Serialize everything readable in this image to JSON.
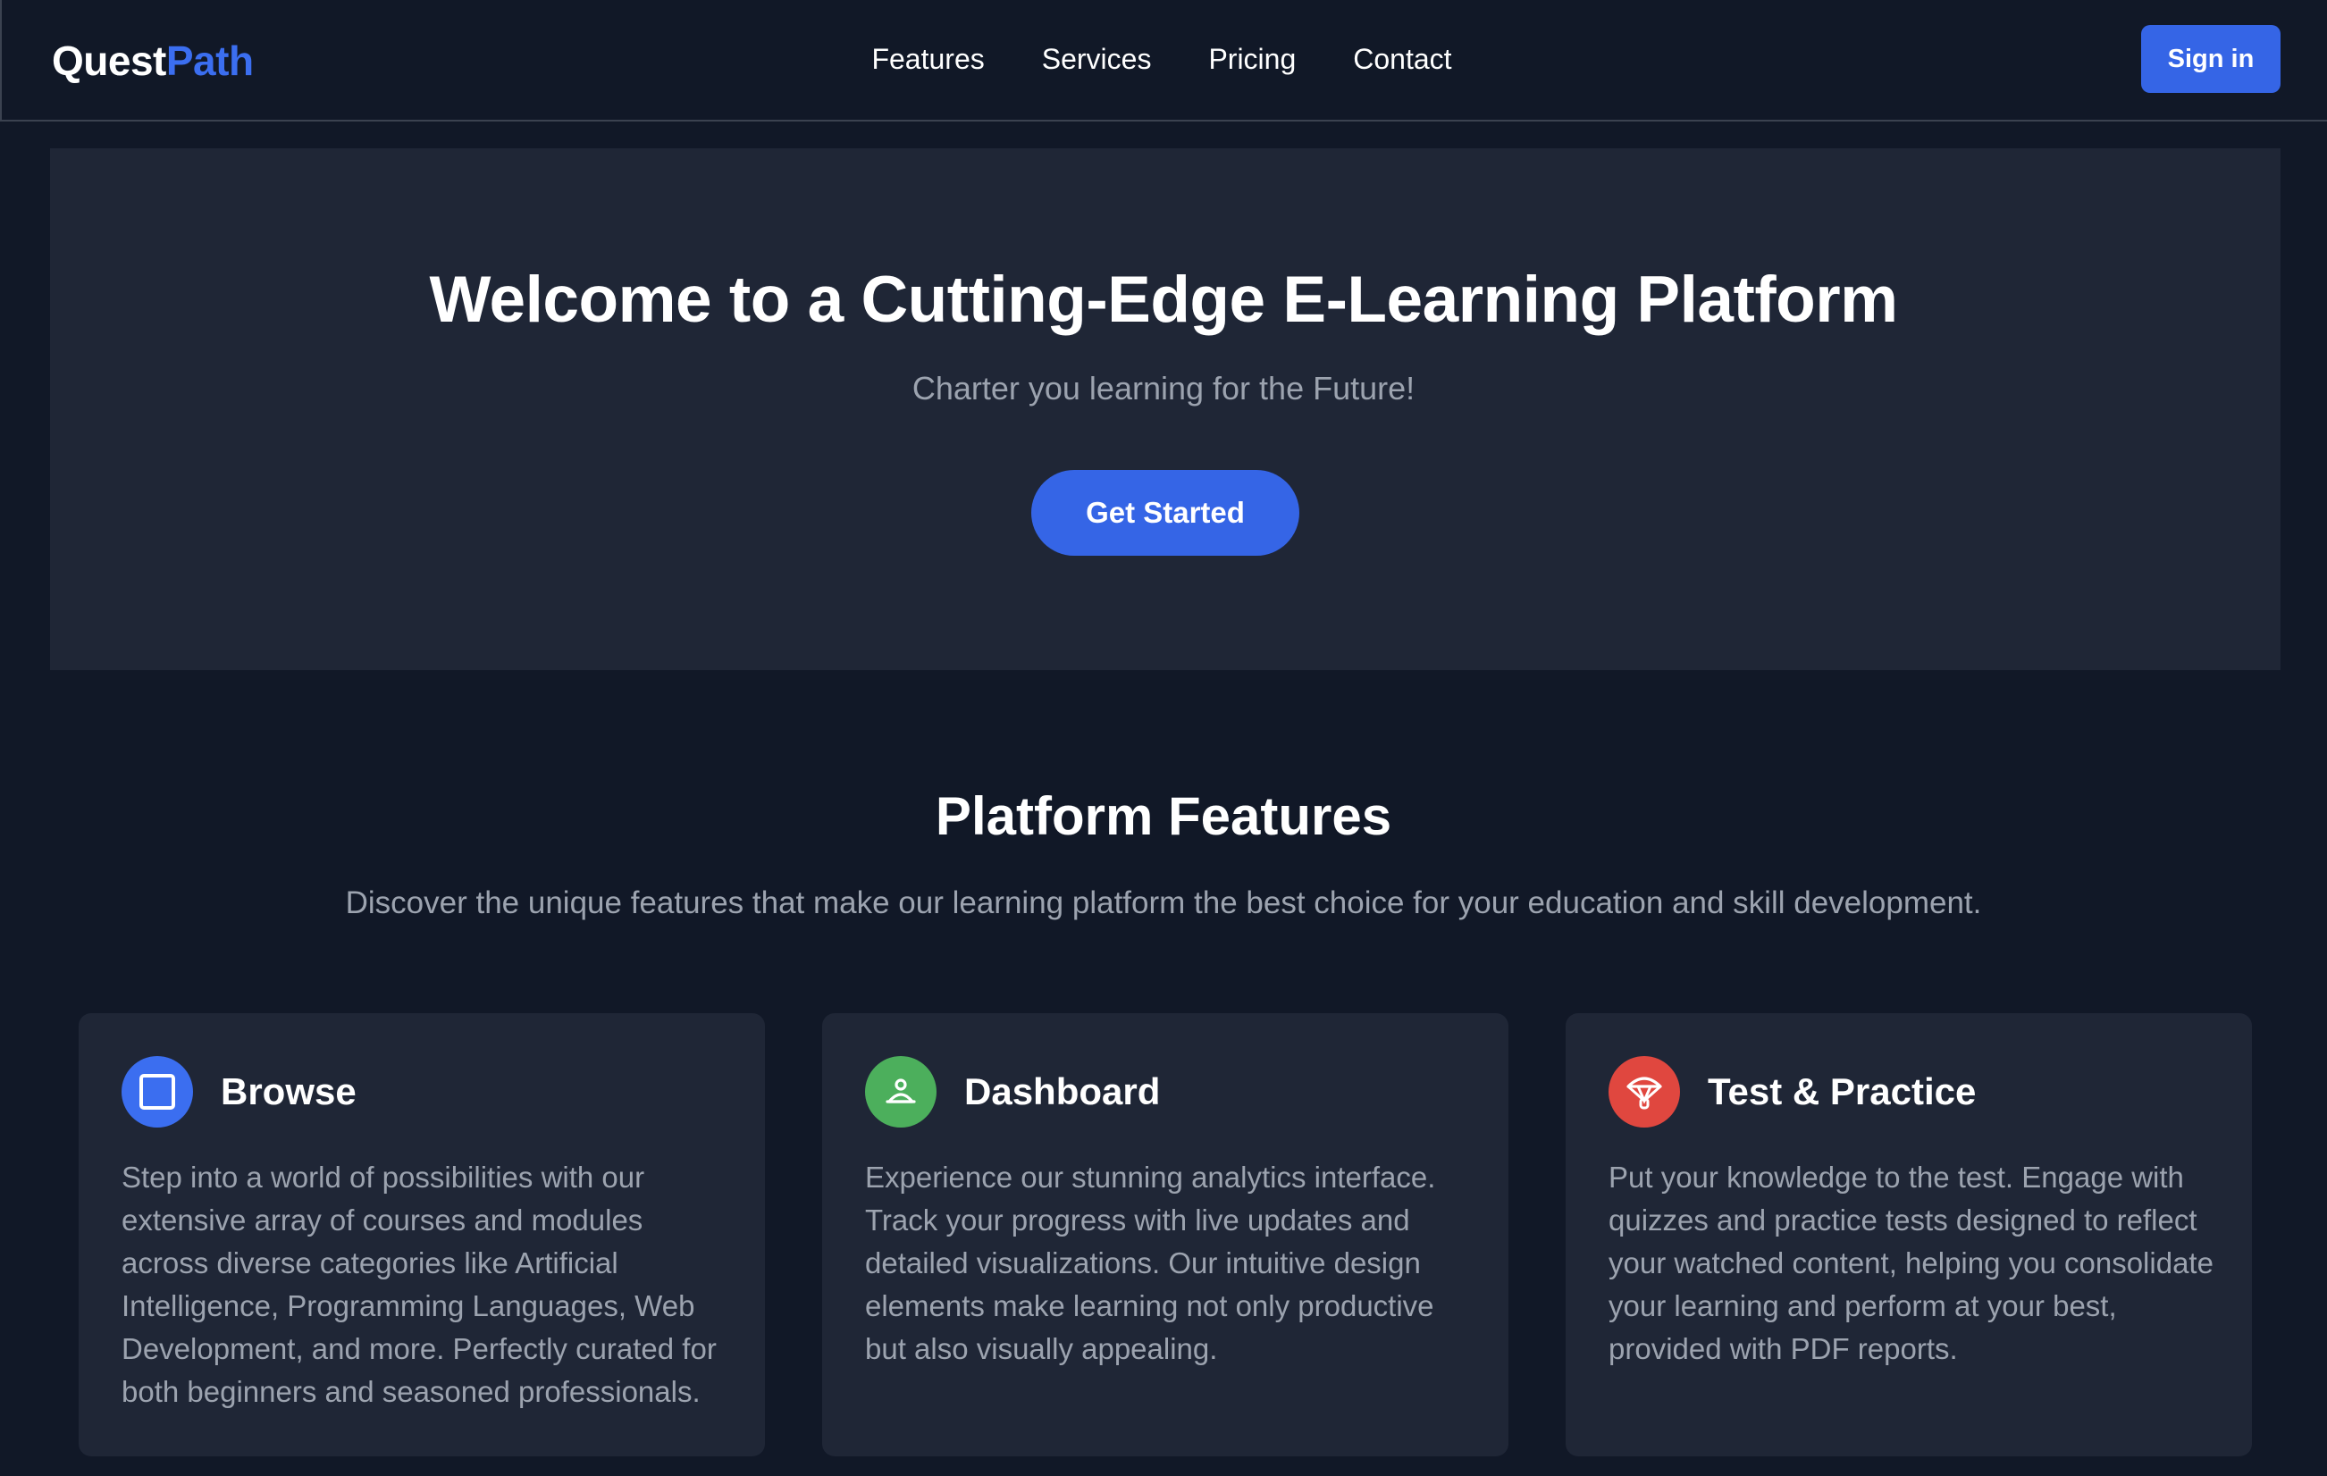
{
  "brand": {
    "part_a": "Quest",
    "part_b": "Path"
  },
  "nav": {
    "links": [
      "Features",
      "Services",
      "Pricing",
      "Contact"
    ],
    "signin_label": "Sign in"
  },
  "hero": {
    "title": "Welcome to a Cutting-Edge E-Learning Platform",
    "subtitle": "Charter you learning for the Future!",
    "cta_label": "Get Started"
  },
  "features": {
    "title": "Platform Features",
    "subtitle": "Discover the unique features that make our learning platform the best choice for your education and skill development.",
    "cards": [
      {
        "icon": "square-icon",
        "icon_color": "#3b6ef0",
        "title": "Browse",
        "body": "Step into a world of possibilities with our extensive array of courses and modules across diverse categories like Artificial Intelligence, Programming Languages, Web Development, and more. Perfectly curated for both beginners and seasoned professionals."
      },
      {
        "icon": "user-dashboard-icon",
        "icon_color": "#4caf5c",
        "title": "Dashboard",
        "body": "Experience our stunning analytics interface. Track your progress with live updates and detailed visualizations. Our intuitive design elements make learning not only productive but also visually appealing."
      },
      {
        "icon": "parachute-icon",
        "icon_color": "#e0473f",
        "title": "Test & Practice",
        "body": "Put your knowledge to the test. Engage with quizzes and practice tests designed to reflect your watched content, helping you consolidate your learning and perform at your best, provided with PDF reports."
      }
    ]
  },
  "colors": {
    "background": "#111827",
    "panel": "#1f2636",
    "accent": "#3565e6",
    "muted_text": "#9ca3af"
  }
}
